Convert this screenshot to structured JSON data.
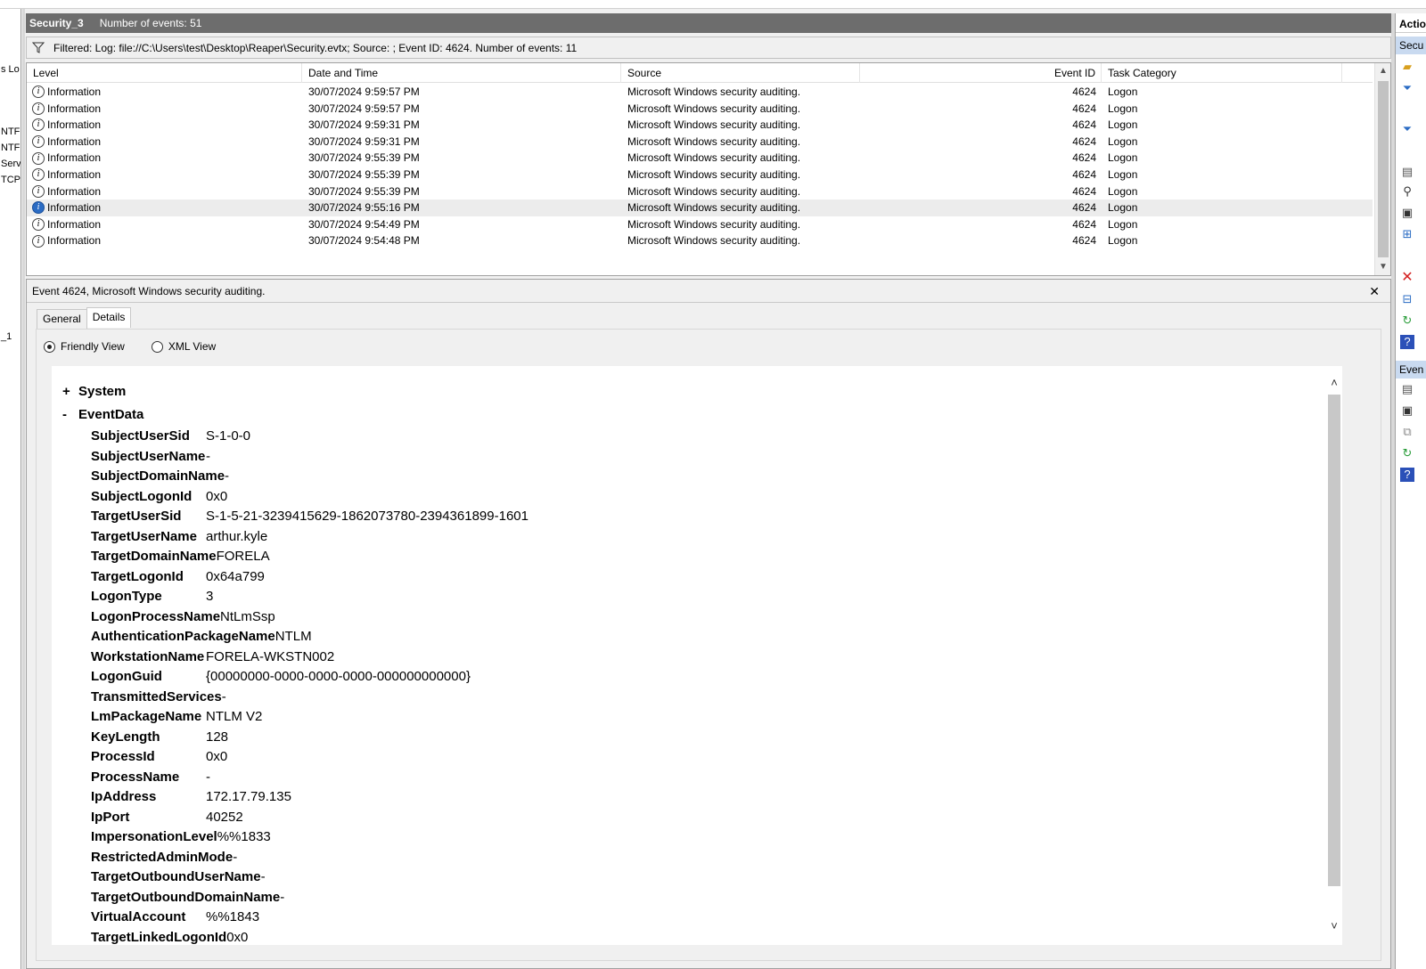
{
  "left_tree": {
    "fragments": [
      "s Lo",
      "NTF",
      "NTF",
      "Serv",
      "TCP",
      "_1"
    ]
  },
  "title_bar": {
    "title": "Security_3",
    "event_count": "Number of events: 51"
  },
  "filter": {
    "text": "Filtered: Log: file://C:\\Users\\test\\Desktop\\Reaper\\Security.evtx; Source: ; Event ID: 4624. Number of events: 11"
  },
  "grid": {
    "columns": [
      "Level",
      "Date and Time",
      "Source",
      "Event ID",
      "Task Category"
    ],
    "rows": [
      {
        "level": "Information",
        "datetime": "30/07/2024 9:59:57 PM",
        "source": "Microsoft Windows security auditing.",
        "event_id": "4624",
        "task": "Logon"
      },
      {
        "level": "Information",
        "datetime": "30/07/2024 9:59:57 PM",
        "source": "Microsoft Windows security auditing.",
        "event_id": "4624",
        "task": "Logon"
      },
      {
        "level": "Information",
        "datetime": "30/07/2024 9:59:31 PM",
        "source": "Microsoft Windows security auditing.",
        "event_id": "4624",
        "task": "Logon"
      },
      {
        "level": "Information",
        "datetime": "30/07/2024 9:59:31 PM",
        "source": "Microsoft Windows security auditing.",
        "event_id": "4624",
        "task": "Logon"
      },
      {
        "level": "Information",
        "datetime": "30/07/2024 9:55:39 PM",
        "source": "Microsoft Windows security auditing.",
        "event_id": "4624",
        "task": "Logon"
      },
      {
        "level": "Information",
        "datetime": "30/07/2024 9:55:39 PM",
        "source": "Microsoft Windows security auditing.",
        "event_id": "4624",
        "task": "Logon"
      },
      {
        "level": "Information",
        "datetime": "30/07/2024 9:55:39 PM",
        "source": "Microsoft Windows security auditing.",
        "event_id": "4624",
        "task": "Logon"
      },
      {
        "level": "Information",
        "datetime": "30/07/2024 9:55:16 PM",
        "source": "Microsoft Windows security auditing.",
        "event_id": "4624",
        "task": "Logon",
        "selected": true
      },
      {
        "level": "Information",
        "datetime": "30/07/2024 9:54:49 PM",
        "source": "Microsoft Windows security auditing.",
        "event_id": "4624",
        "task": "Logon"
      },
      {
        "level": "Information",
        "datetime": "30/07/2024 9:54:48 PM",
        "source": "Microsoft Windows security auditing.",
        "event_id": "4624",
        "task": "Logon"
      }
    ]
  },
  "detail": {
    "header": "Event 4624, Microsoft Windows security auditing.",
    "close_glyph": "✕",
    "tabs": [
      "General",
      "Details"
    ],
    "active_tab": "Details",
    "views": [
      "Friendly View",
      "XML View"
    ],
    "selected_view": "Friendly View",
    "system_node": {
      "sign": "+",
      "label": "System"
    },
    "eventdata_node": {
      "sign": "-",
      "label": "EventData"
    },
    "fields": [
      {
        "k": "SubjectUserSid",
        "v": "S-1-0-0"
      },
      {
        "k": "SubjectUserName",
        "v": "-"
      },
      {
        "k": "SubjectDomainName",
        "v": "-"
      },
      {
        "k": "SubjectLogonId",
        "v": "0x0"
      },
      {
        "k": "TargetUserSid",
        "v": "S-1-5-21-3239415629-1862073780-2394361899-1601"
      },
      {
        "k": "TargetUserName",
        "v": "arthur.kyle"
      },
      {
        "k": "TargetDomainName",
        "v": "FORELA"
      },
      {
        "k": "TargetLogonId",
        "v": "0x64a799"
      },
      {
        "k": "LogonType",
        "v": "3"
      },
      {
        "k": "LogonProcessName",
        "v": "NtLmSsp"
      },
      {
        "k": "AuthenticationPackageName",
        "v": "NTLM"
      },
      {
        "k": "WorkstationName",
        "v": "FORELA-WKSTN002"
      },
      {
        "k": "LogonGuid",
        "v": "{00000000-0000-0000-0000-000000000000}"
      },
      {
        "k": "TransmittedServices",
        "v": "-"
      },
      {
        "k": "LmPackageName",
        "v": "NTLM V2"
      },
      {
        "k": "KeyLength",
        "v": "128"
      },
      {
        "k": "ProcessId",
        "v": "0x0"
      },
      {
        "k": "ProcessName",
        "v": "-"
      },
      {
        "k": "IpAddress",
        "v": "172.17.79.135"
      },
      {
        "k": "IpPort",
        "v": "40252"
      },
      {
        "k": "ImpersonationLevel",
        "v": "%%1833"
      },
      {
        "k": "RestrictedAdminMode",
        "v": "-"
      },
      {
        "k": "TargetOutboundUserName",
        "v": "-"
      },
      {
        "k": "TargetOutboundDomainName",
        "v": "-"
      },
      {
        "k": "VirtualAccount",
        "v": "%%1843"
      },
      {
        "k": "TargetLinkedLogonId",
        "v": "0x0"
      }
    ]
  },
  "actions_pane": {
    "header": "Actio",
    "section_1": "Secu",
    "section_2": "Even"
  },
  "colors": {
    "title_bar_bg": "#6d6d6d",
    "selected_row_bg": "#ececec",
    "section_blue": "#c9daf0",
    "delete_red": "#d42020"
  }
}
